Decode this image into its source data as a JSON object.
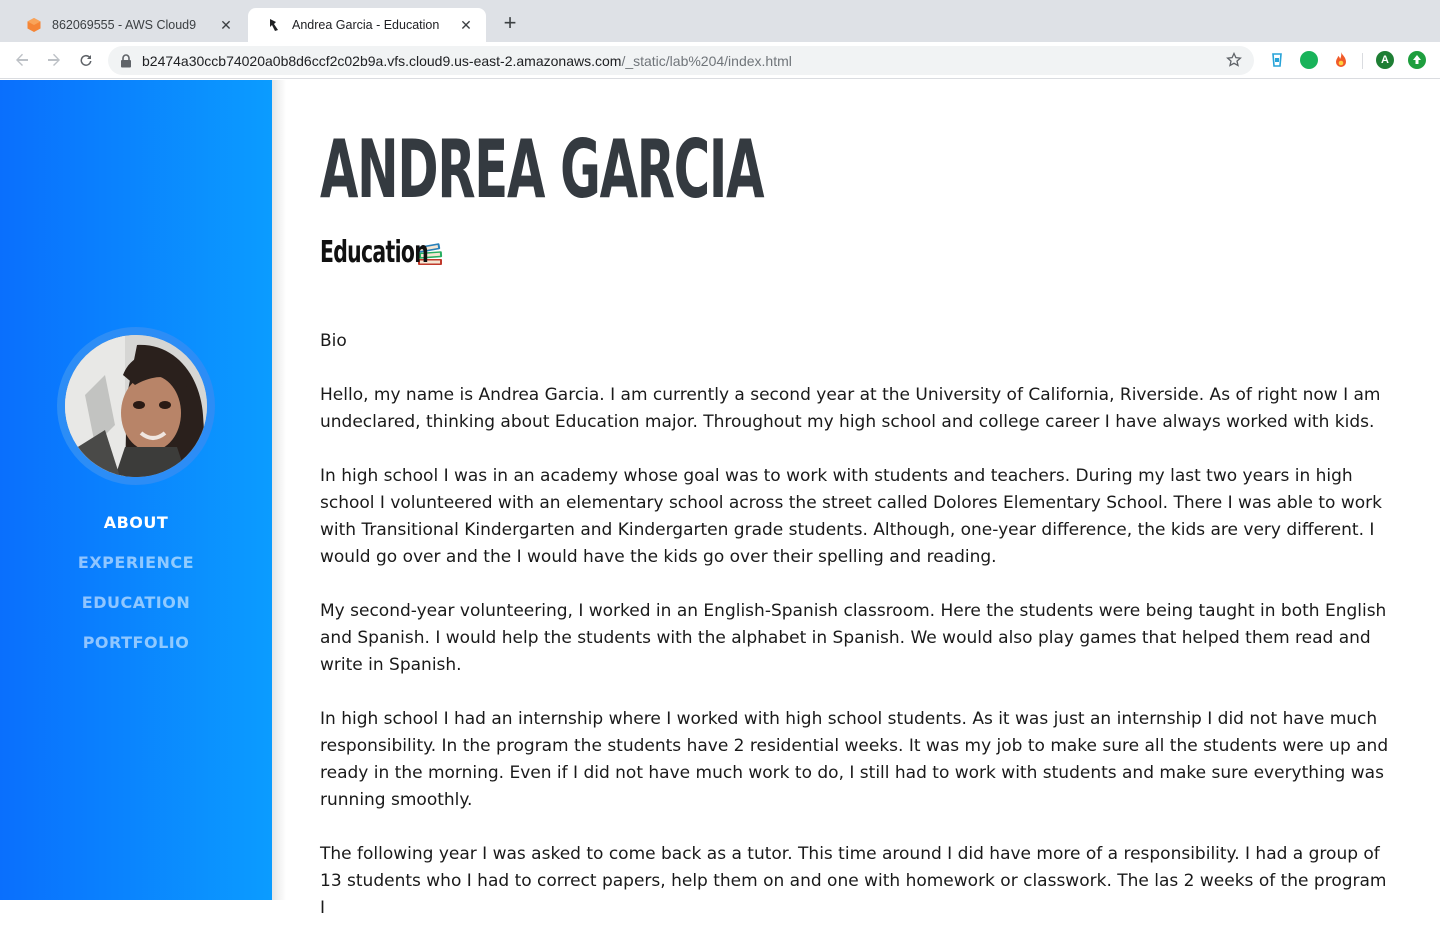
{
  "browser": {
    "tabs": [
      {
        "title": "862069555 - AWS Cloud9",
        "favicon": "aws-cloud9-icon",
        "active": false
      },
      {
        "title": "Andrea Garcia - Education",
        "favicon": "page-icon",
        "active": true
      }
    ],
    "url_host": "b2474a30ccb74020a0b8d6ccf2c02b9a.vfs.cloud9.us-east-2.amazonaws.com",
    "url_path": "/_static/lab%204/index.html",
    "profile_initial": "A"
  },
  "sidebar": {
    "nav": [
      {
        "label": "ABOUT",
        "current": true
      },
      {
        "label": "EXPERIENCE",
        "current": false
      },
      {
        "label": "EDUCATION",
        "current": false
      },
      {
        "label": "PORTFOLIO",
        "current": false
      }
    ]
  },
  "main": {
    "name": "ANDREA GARCIA",
    "section_title": "Education",
    "bio_heading": "Bio",
    "paragraphs": [
      "Hello, my name is Andrea Garcia. I am currently a second year at the University of California, Riverside. As of right now I am undeclared, thinking about Education major. Throughout my high school and college career I have always worked with kids.",
      "In high school I was in an academy whose goal was to work with students and teachers. During my last two years in high school I volunteered with an elementary school across the street called Dolores Elementary School. There I was able to work with Transitional Kindergarten and Kindergarten grade students. Although, one-year difference, the kids are very different. I would go over and the I would have the kids go over their spelling and reading.",
      "My second-year volunteering, I worked in an English-Spanish classroom. Here the students were being taught in both English and Spanish. I would help the students with the alphabet in Spanish. We would also play games that helped them read and write in Spanish.",
      "In high school I had an internship where I worked with high school students. As it was just an internship I did not have much responsibility. In the program the students have 2 residential weeks. It was my job to make sure all the students were up and ready in the morning. Even if I did not have much work to do, I still had to work with students and make sure everything was running smoothly.",
      "The following year I was asked to come back as a tutor. This time around I did have more of a responsibility. I had a group of 13 students who I had to correct papers, help them on and one with homework or classwork. The las 2 weeks of the program I"
    ]
  },
  "colors": {
    "sidebar_start": "#0a6ffd",
    "sidebar_end": "#0b9cff",
    "heading": "#343a40"
  }
}
